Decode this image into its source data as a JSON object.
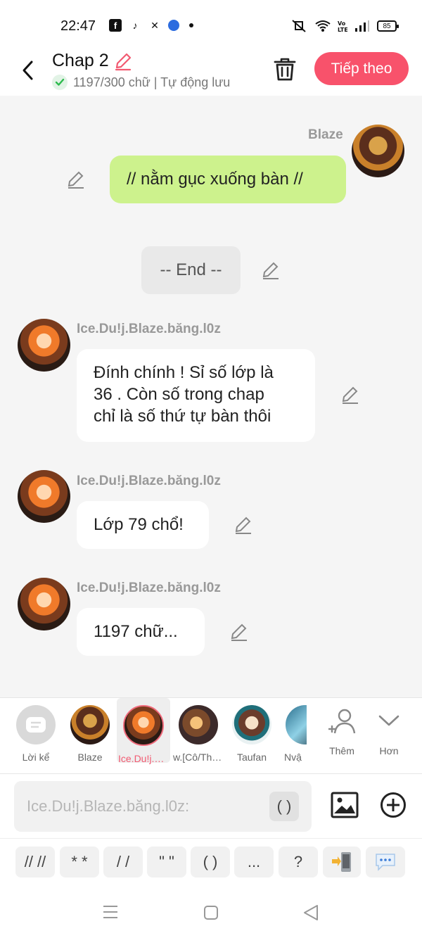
{
  "status_bar": {
    "time": "22:47",
    "battery": "85"
  },
  "header": {
    "title": "Chap 2",
    "subtitle": "1197/300 chữ | Tự động lưu",
    "next_label": "Tiếp theo"
  },
  "messages": [
    {
      "sender": "Blaze",
      "text": "// nằm gục xuống bàn //",
      "side": "right"
    },
    {
      "text": "-- End --",
      "type": "narration"
    },
    {
      "sender": "Ice.Du!j.Blaze.băng.l0z",
      "text_lines": [
        "Đính chính ! Sỉ số lớp là",
        "36 . Còn số trong chap",
        "chỉ là số thứ tự bàn thôi"
      ],
      "side": "left"
    },
    {
      "sender": "Ice.Du!j.Blaze.băng.l0z",
      "text": "Lớp 79 chổ!",
      "side": "left"
    },
    {
      "sender": "Ice.Du!j.Blaze.băng.l0z",
      "text": "1197 chữ...",
      "side": "left"
    }
  ],
  "characters": [
    {
      "label": "Lời kể"
    },
    {
      "label": "Blaze"
    },
    {
      "label": "Ice.Du!j.Bl..."
    },
    {
      "label": "w.[Cô/Thầ..."
    },
    {
      "label": "Taufan"
    },
    {
      "label": "Nvậ"
    }
  ],
  "character_actions": {
    "add_label": "Thêm",
    "more_label": "Hơn"
  },
  "input": {
    "placeholder": "Ice.Du!j.Blaze.băng.l0z:",
    "paren_label": "( )"
  },
  "shortcuts": [
    "// //",
    "* *",
    "/ /",
    "\" \"",
    "( )",
    "...",
    "?"
  ]
}
